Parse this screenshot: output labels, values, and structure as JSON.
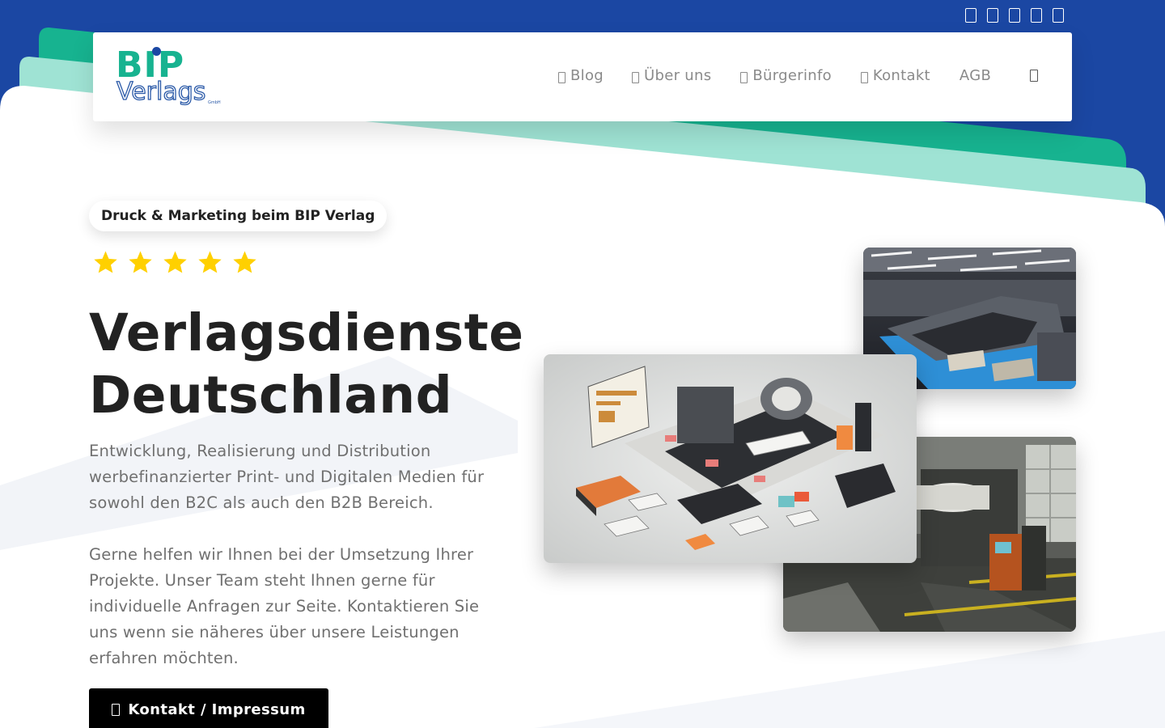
{
  "header": {
    "social_icons": [
      "social-icon-1",
      "social-icon-2",
      "social-icon-3",
      "social-icon-4",
      "social-icon-5"
    ],
    "logo": {
      "line1": "BIP",
      "line2": "Verlags",
      "line3": "GmbH"
    },
    "nav": [
      {
        "label": "Blog",
        "icon": "blog-icon"
      },
      {
        "label": "Über uns",
        "icon": "about-icon"
      },
      {
        "label": "Bürgerinfo",
        "icon": "info-icon"
      },
      {
        "label": "Kontakt",
        "icon": "contact-icon"
      },
      {
        "label": "AGB"
      }
    ],
    "search_icon": "search-icon"
  },
  "hero": {
    "tag": "Druck & Marketing beim BIP Verlag",
    "rating": 5,
    "title_line1": "Verlagsdienste",
    "title_line2": "Deutschland",
    "paragraph1": "Entwicklung, Realisierung und Distribution werbefinanzierter Print- und Digitalen Medien für sowohl den B2C als auch den B2B Bereich.",
    "paragraph2": "Gerne helfen wir Ihnen bei der Umsetzung Ihrer Projekte. Unser Team steht Ihnen gerne für individuelle Anfragen zur Seite. Kontaktieren Sie uns wenn sie näheres über unsere Leistungen erfahren möchten.",
    "button": {
      "label": "Kontakt / Impressum",
      "icon": "contact-card-icon"
    }
  },
  "images": [
    {
      "name": "printing-press-photo"
    },
    {
      "name": "isometric-print-factory-illustration"
    },
    {
      "name": "print-hall-machinery-photo"
    }
  ],
  "colors": {
    "header_blue": "#1b47a3",
    "accent_green": "#17b390",
    "mint": "#9fe3d4",
    "button_black": "#000000",
    "star_yellow": "#ffd000"
  }
}
